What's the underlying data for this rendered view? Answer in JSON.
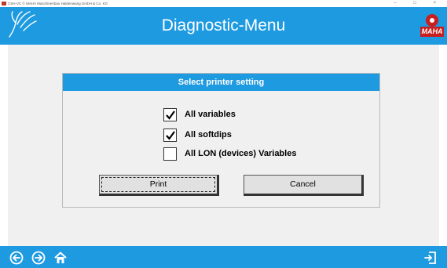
{
  "window": {
    "title": "CSH-VC  © MAHA Maschinenbau Haldenwang GmbH & Co. KG",
    "controls": "–  □  ×"
  },
  "header": {
    "title": "Diagnostic-Menu",
    "logo_text": "MAHA"
  },
  "dialog": {
    "title": "Select printer setting",
    "options": [
      {
        "label": "All variables",
        "checked": true
      },
      {
        "label": "All softdips",
        "checked": true
      },
      {
        "label": "All LON (devices) Variables",
        "checked": false
      }
    ],
    "print_label": "Print",
    "cancel_label": "Cancel"
  },
  "footer": {
    "icons": [
      "back-arrow-icon",
      "forward-arrow-icon",
      "home-icon",
      "exit-icon"
    ]
  },
  "colors": {
    "accent": "#1e9ae0",
    "background": "#f0f0f0",
    "logo_red": "#c81e1e"
  }
}
